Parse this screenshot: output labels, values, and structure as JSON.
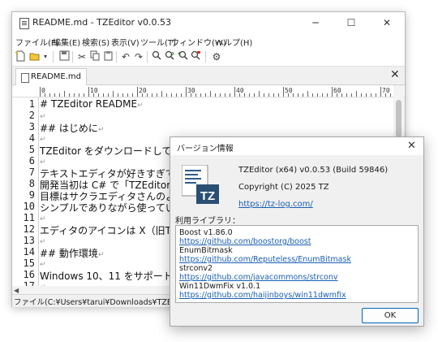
{
  "main_window": {
    "title": "README.md - TZEditor v0.0.53",
    "caption_buttons": {
      "minimize": "─",
      "maximize": "☐",
      "close": "✕"
    },
    "menus": [
      "ファイル(F)",
      "編集(E)",
      "検索(S)",
      "表示(V)",
      "ツール(T)",
      "ウィンドウ(W)",
      "ヘルプ(H)"
    ],
    "toolbar_icons": [
      "new-file-icon",
      "open-file-icon",
      "dropdown-icon",
      "save-icon",
      "cut-icon",
      "copy-icon",
      "paste-icon",
      "undo-icon",
      "redo-icon",
      "find-icon",
      "find-next-icon",
      "find-previous-icon",
      "replace-icon",
      "settings-icon"
    ],
    "tab": {
      "label": "README.md",
      "close": "✕"
    },
    "ruler_labels": [
      "0",
      "10",
      "20",
      "30",
      "40",
      "50",
      "60",
      "70"
    ],
    "editor_lines": [
      {
        "n": "1",
        "text": "# TZEditor README"
      },
      {
        "n": "2",
        "text": ""
      },
      {
        "n": "3",
        "text": "## はじめに"
      },
      {
        "n": "4",
        "text": ""
      },
      {
        "n": "5",
        "text": "TZEditor をダウンロードして頂きありがとうございます。"
      },
      {
        "n": "6",
        "text": ""
      },
      {
        "n": "7",
        "text": "テキストエディタが好きすぎて"
      },
      {
        "n": "8",
        "text": "開発当初は C# で「TZEditor."
      },
      {
        "n": "9",
        "text": "目標はサクラエディタさんのよ"
      },
      {
        "n": "10",
        "text": "シンプルでありながら使ってい"
      },
      {
        "n": "11",
        "text": ""
      },
      {
        "n": "12",
        "text": "エディタのアイコンは X（旧T"
      },
      {
        "n": "13",
        "text": ""
      },
      {
        "n": "14",
        "text": "## 動作環境"
      },
      {
        "n": "15",
        "text": ""
      },
      {
        "n": "16",
        "text": "Windows 10、11 をサポートし"
      },
      {
        "n": "17",
        "text": ""
      }
    ],
    "eol_mark": "↵",
    "status": "ファイル(C:¥Users¥tarui¥Downloads¥TZEditor-x64-"
  },
  "about_dialog": {
    "title": "バージョン情報",
    "close": "✕",
    "logo_text": "TZ",
    "app_name": "TZEditor (x64) v0.0.53 (Build 59846)",
    "copyright": "Copyright (C) 2025 TZ",
    "homepage": "https://tz-log.com/",
    "libraries_label": "利用ライブラリ：",
    "libraries": [
      {
        "text": "Boost v1.86.0",
        "link": false
      },
      {
        "text": "https://github.com/boostorg/boost",
        "link": true
      },
      {
        "text": "EnumBitmask",
        "link": false
      },
      {
        "text": "https://github.com/Reputeless/EnumBitmask",
        "link": true
      },
      {
        "text": "strconv2",
        "link": false
      },
      {
        "text": "https://github.com/javacommons/strconv",
        "link": true
      },
      {
        "text": "Win11DwmFix v1.0.1",
        "link": false
      },
      {
        "text": "https://github.com/haijinboys/win11dwmfix",
        "link": true
      }
    ],
    "ok_label": "OK",
    "accent_color": "#0067c0",
    "link_color": "#1a5fb4"
  }
}
